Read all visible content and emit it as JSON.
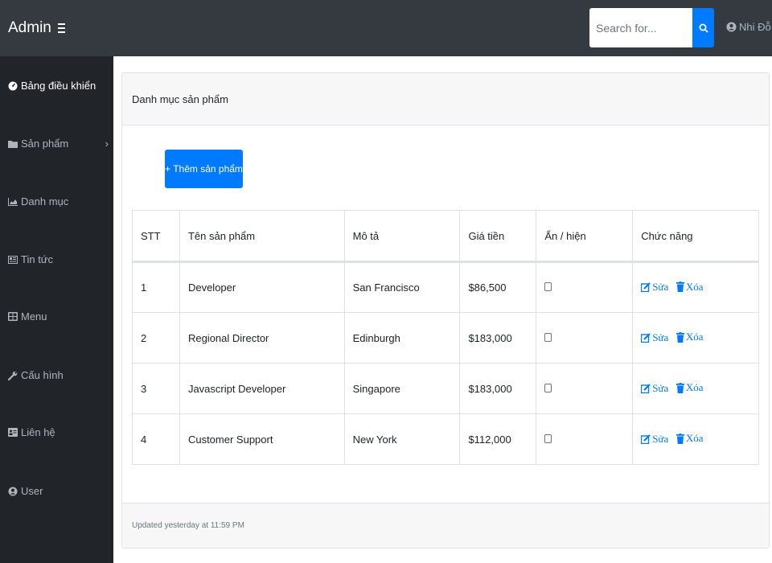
{
  "topbar": {
    "brand": "Admin",
    "search_placeholder": "Search for...",
    "user_name": "Nhi Đỗ"
  },
  "sidebar": {
    "items": [
      {
        "label": "Bảng điều khiển",
        "icon": "dashboard-icon",
        "active": true
      },
      {
        "label": "Sản phẩm",
        "icon": "folder-icon",
        "has_submenu": true
      },
      {
        "label": "Danh mục",
        "icon": "area-chart-icon"
      },
      {
        "label": "Tin tức",
        "icon": "news-icon"
      },
      {
        "label": "Menu",
        "icon": "grid-icon"
      },
      {
        "label": "Cấu hình",
        "icon": "wrench-icon"
      },
      {
        "label": "Liên hệ",
        "icon": "contact-card-icon"
      },
      {
        "label": "User",
        "icon": "user-circle-icon"
      }
    ]
  },
  "card": {
    "header": "Danh mục sản phẩm",
    "add_button": "+ Thêm sản phẩm",
    "footer": "Updated yesterday at 11:59 PM"
  },
  "table": {
    "headers": [
      "STT",
      "Tên sản phẩm",
      "Mô tả",
      "Giá tiền",
      "Ẩn / hiện",
      "Chức năng"
    ],
    "rows": [
      {
        "stt": "1",
        "name": "Developer",
        "desc": "San Francisco",
        "price": "$86,500",
        "hidden": false
      },
      {
        "stt": "2",
        "name": "Regional Director",
        "desc": "Edinburgh",
        "price": "$183,000",
        "hidden": false
      },
      {
        "stt": "3",
        "name": "Javascript Developer",
        "desc": "Singapore",
        "price": "$183,000",
        "hidden": false
      },
      {
        "stt": "4",
        "name": "Customer Support",
        "desc": "New York",
        "price": "$112,000",
        "hidden": false
      }
    ],
    "edit_label": "Sửa",
    "delete_label": "Xóa"
  },
  "colors": {
    "topbar": "#343a40",
    "sidebar": "#212529",
    "primary": "#007bff",
    "card_header_bg": "#f7f7f7"
  }
}
